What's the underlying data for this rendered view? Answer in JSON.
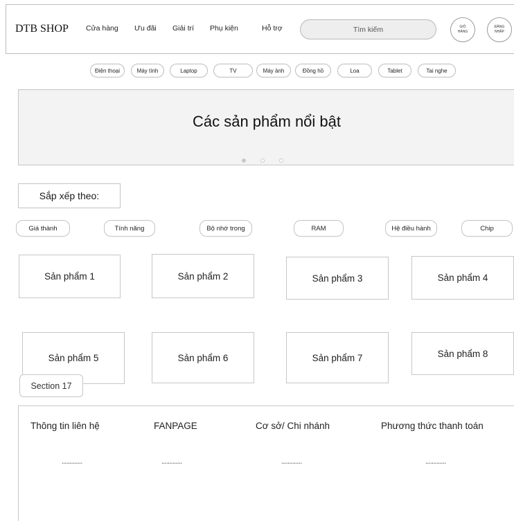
{
  "header": {
    "logo": "DTB SHOP",
    "nav": [
      "Cửa hàng",
      "Ưu đãi",
      "Giải trí",
      "Phụ kiện",
      "Hỗ trợ"
    ],
    "search_placeholder": "Tìm kiếm",
    "cart": [
      "GIỎ",
      "HÀNG"
    ],
    "login": [
      "ĐĂNG",
      "NHẬP"
    ]
  },
  "categories": [
    "Điện thoại",
    "Máy tính",
    "Laptop",
    "TV",
    "Máy ảnh",
    "Đồng hồ",
    "Loa",
    "Tablet",
    "Tai nghe"
  ],
  "banner": {
    "title": "Các sản phẩm nổi bật",
    "active_slide": 1,
    "slide_count": 3
  },
  "sort": {
    "label": "Sắp xếp theo:",
    "filters": [
      "Giá thành",
      "Tính năng",
      "Bộ nhớ trong",
      "RAM",
      "Hệ điều hành",
      "Chip"
    ]
  },
  "products": [
    "Sản phẩm 1",
    "Sản phẩm 2",
    "Sản phẩm 3",
    "Sản phẩm 4",
    "Sản phẩm 5",
    "Sản phẩm 6",
    "Sản phẩm 7",
    "Sản phẩm 8"
  ],
  "section": {
    "label": "Section 17"
  },
  "footer": {
    "columns": [
      {
        "title": "Thông tin liên hệ",
        "value": "............."
      },
      {
        "title": "FANPAGE",
        "value": "............."
      },
      {
        "title": "Cơ sở/ Chi nhánh",
        "value": "............."
      },
      {
        "title": "Phương thức thanh toán",
        "value": "............."
      }
    ]
  },
  "colors": {
    "banner_bg": "#f3f3f3",
    "search_bg": "#eeeeee",
    "dot_active": "#c9c9c9",
    "border": "#c3c3c3"
  }
}
